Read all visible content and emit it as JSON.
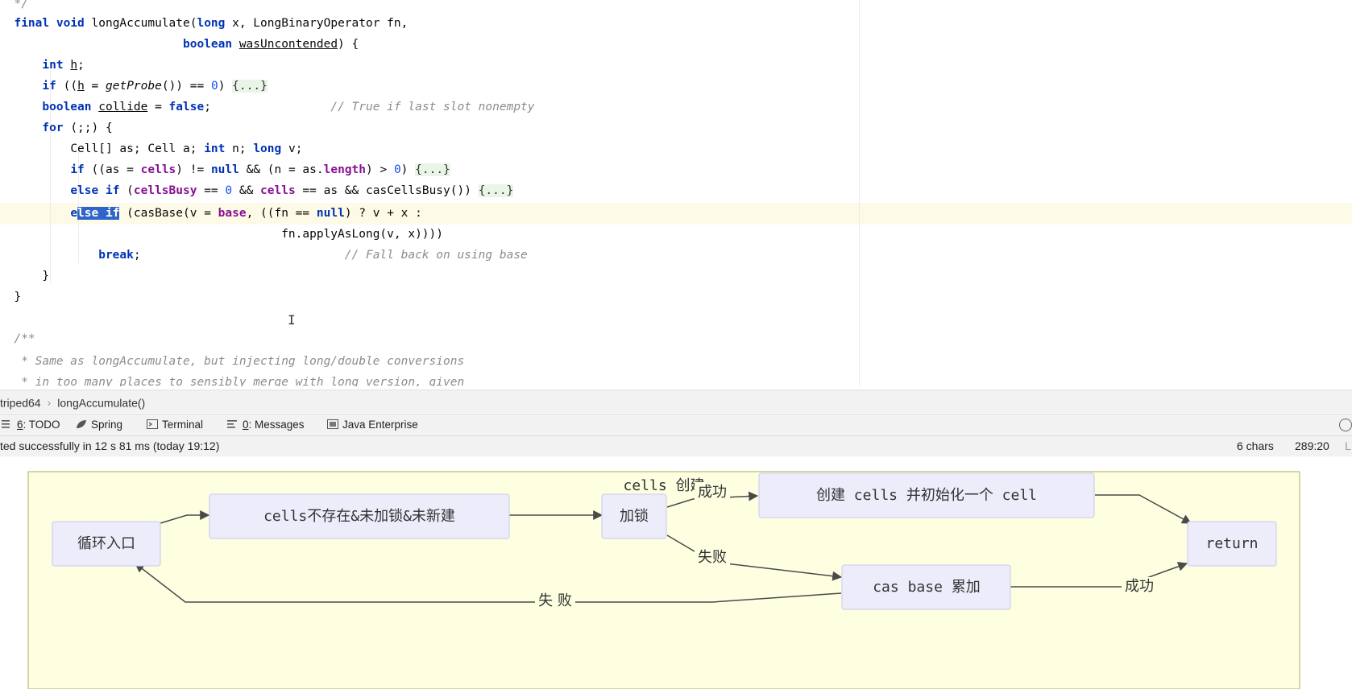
{
  "editor": {
    "code": {
      "line0": "*/",
      "line1": {
        "kw1": "final",
        "kw2": "void",
        "name": " longAccumulate(",
        "kw3": "long",
        "rest": " x, LongBinaryOperator fn,"
      },
      "line2": {
        "kw": "boolean",
        "param": "wasUncontended",
        "rest": ") {"
      },
      "line3": {
        "kw": "int",
        "var": "h",
        "end": ";"
      },
      "line4": {
        "kw": "if",
        "a": " ((",
        "var": "h",
        "b": " = ",
        "call": "getProbe",
        "c": "()) == ",
        "num": "0",
        "d": ") ",
        "fold": "{...}"
      },
      "line5": {
        "kw": "boolean",
        "var": "collide",
        "a": " = ",
        "kw2": "false",
        "b": ";",
        "comment": "// True if last slot nonempty"
      },
      "line6": {
        "kw": "for",
        "rest": " (;;) {"
      },
      "line7": {
        "a": "Cell[] as; Cell a; ",
        "kw1": "int",
        "b": " n; ",
        "kw2": "long",
        "c": " v;"
      },
      "line8": {
        "kw": "if",
        "a": " ((as = ",
        "field": "cells",
        "b": ") != ",
        "kw2": "null",
        "c": " && (n = as.",
        "field2": "length",
        "d": ") > ",
        "num": "0",
        "e": ") ",
        "fold": "{...}"
      },
      "line9": {
        "kw": "else if",
        "a": " (",
        "field": "cellsBusy",
        "b": " == ",
        "num": "0",
        "c": " && ",
        "field2": "cells",
        "d": " == as && casCellsBusy()) ",
        "fold": "{...}"
      },
      "line10": {
        "pre": "e",
        "sel": "lse if",
        "a": " (casBase(v = ",
        "field": "base",
        "b": ", ((fn == ",
        "kw2": "null",
        "c": ") ? v + x :"
      },
      "line11": "fn.applyAsLong(v, x))))",
      "line12": {
        "kw": "break",
        "a": ";",
        "comment": "// Fall back on using base"
      },
      "line13": "}",
      "line14": "}",
      "line15": "/**",
      "line16": " * Same as longAccumulate, but injecting long/double conversions",
      "line17": " * in too many places to sensibly merge with long version, given"
    }
  },
  "breadcrumb": {
    "item1": "triped64",
    "sep": "›",
    "item2": "longAccumulate()"
  },
  "toolwindows": {
    "todo": {
      "num": "6",
      "label": ": TODO"
    },
    "spring": "Spring",
    "terminal": "Terminal",
    "messages": {
      "num": "0",
      "label": ": Messages"
    },
    "javaee": "Java Enterprise"
  },
  "statusbar": {
    "message": "ted successfully in 12 s 81 ms (today 19:12)",
    "chars": "6 chars",
    "position": "289:20",
    "extra": "L"
  },
  "diagram": {
    "title": "cells 创建",
    "nodes": {
      "loop": "循环入口",
      "check": "cells不存在&未加锁&未新建",
      "lock": "加锁",
      "create": "创建 cells 并初始化一个 cell",
      "cas": "cas base 累加",
      "ret": "return"
    },
    "edges": {
      "success1": "成功",
      "fail1": "失败",
      "success2": "成功",
      "fail2": "失 败"
    },
    "colors": {
      "cluster_bg": "#fefee0",
      "cluster_border": "#c9c98a",
      "node_bg": "#ececfb"
    }
  }
}
